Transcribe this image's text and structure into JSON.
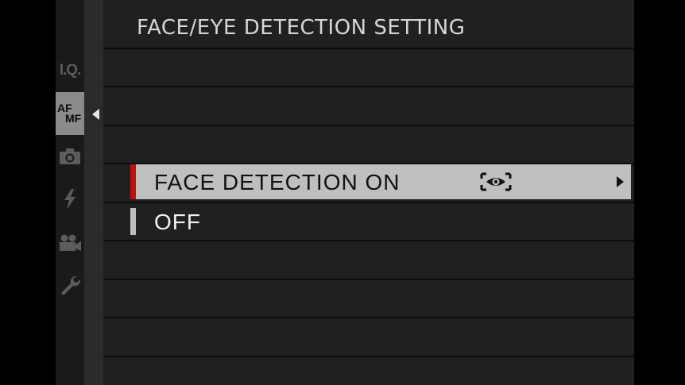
{
  "title": "FACE/EYE DETECTION SETTING",
  "sidebar": {
    "tabs": [
      {
        "id": "iq",
        "label": "I.Q.",
        "icon": "image-quality-icon"
      },
      {
        "id": "afmf",
        "label_af": "AF",
        "label_mf": "MF",
        "icon": "af-mf-icon",
        "active": true
      },
      {
        "id": "camera",
        "icon": "camera-icon"
      },
      {
        "id": "flash",
        "icon": "flash-icon"
      },
      {
        "id": "movie",
        "icon": "movie-camera-icon"
      },
      {
        "id": "setup",
        "icon": "wrench-icon"
      }
    ]
  },
  "menu": {
    "items": [
      {
        "label": "FACE DETECTION ON",
        "icon": "eye-detection-icon",
        "selected": true,
        "has_submenu": true
      },
      {
        "label": "OFF",
        "selected": false
      }
    ]
  },
  "colors": {
    "selection_bg": "#bfbfbf",
    "selection_marker": "#c01010",
    "panel_bg": "#202020"
  }
}
